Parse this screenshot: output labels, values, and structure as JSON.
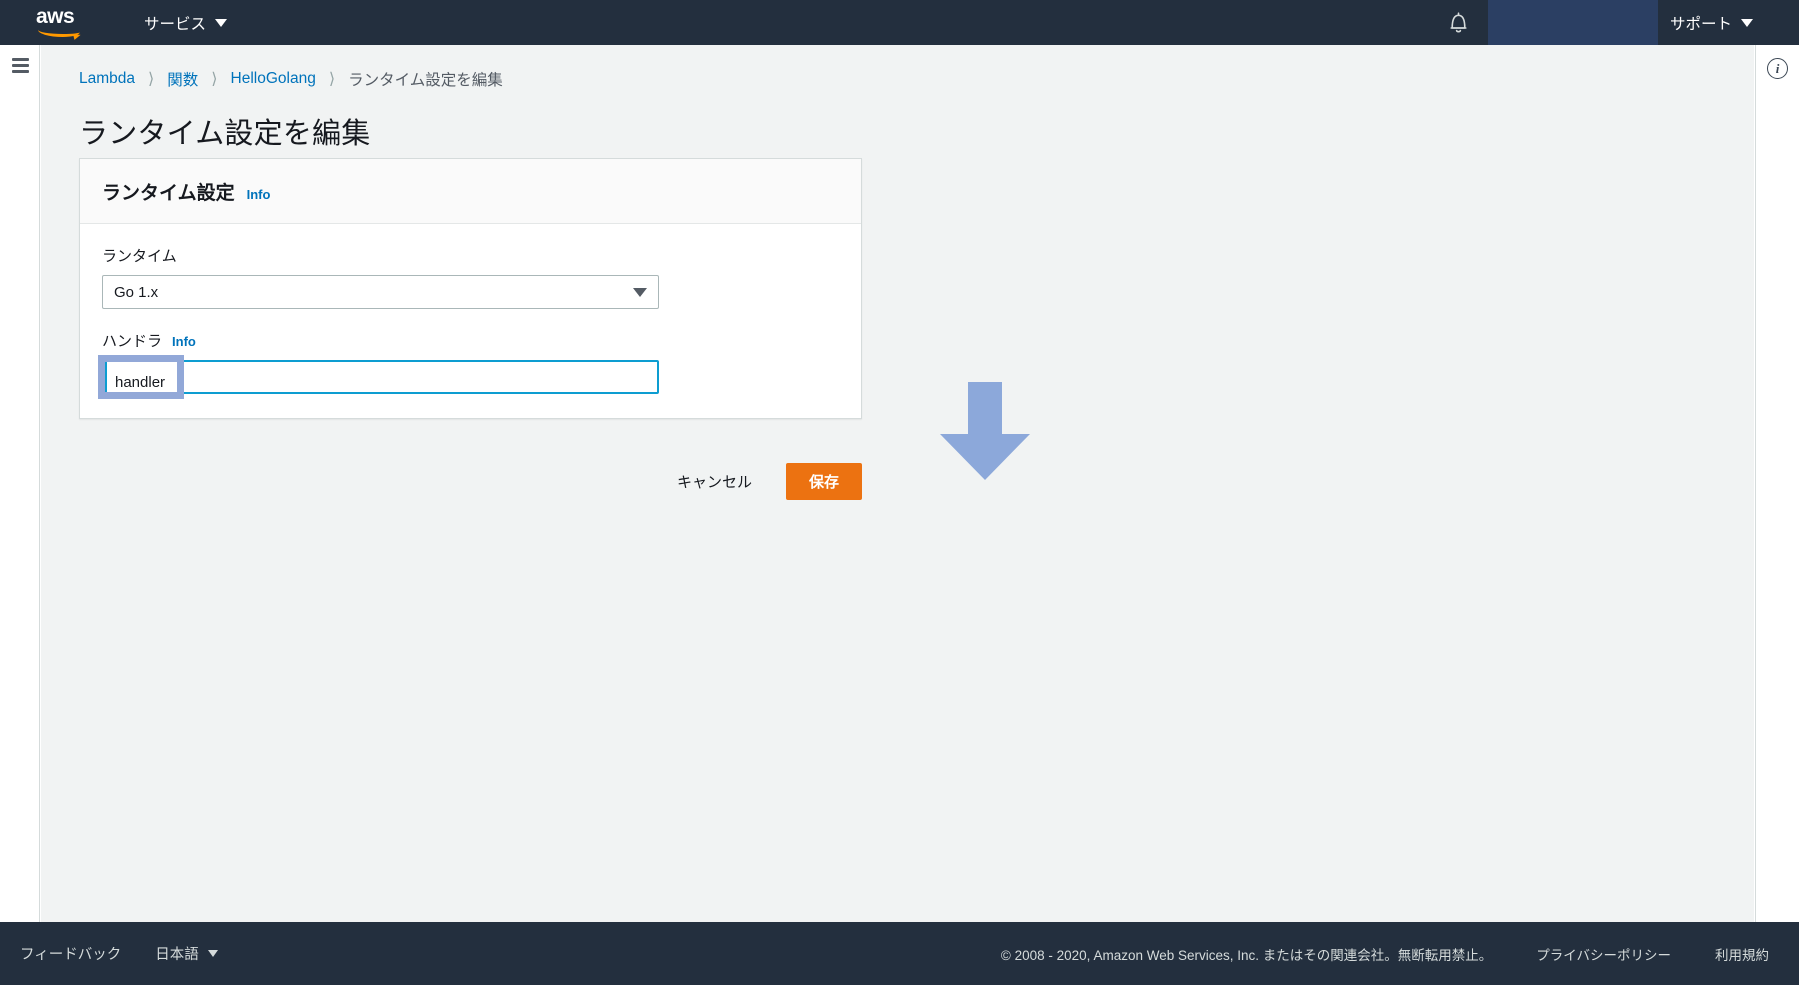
{
  "topnav": {
    "logo_alt": "aws",
    "services_label": "サービス",
    "support_label": "サポート",
    "bell_icon": "notification-bell-icon",
    "account_block_label": ""
  },
  "rails": {
    "menu_icon": "hamburger-menu-icon",
    "info_icon": "info-circle-icon"
  },
  "breadcrumb": {
    "items": [
      {
        "label": "Lambda",
        "is_link": true
      },
      {
        "label": "関数",
        "is_link": true
      },
      {
        "label": "HelloGolang",
        "is_link": true
      },
      {
        "label": "ランタイム設定を編集",
        "is_link": false
      }
    ],
    "separator": "〉"
  },
  "page": {
    "title": "ランタイム設定を編集"
  },
  "card": {
    "title": "ランタイム設定",
    "info_label": "Info",
    "runtime": {
      "label": "ランタイム",
      "selected": "Go 1.x",
      "caret_icon": "chevron-down-icon"
    },
    "handler": {
      "label": "ハンドラ",
      "info_label": "Info",
      "value": "handler",
      "placeholder": "handler"
    }
  },
  "actions": {
    "cancel_label": "キャンセル",
    "save_label": "保存"
  },
  "annotation": {
    "arrow_icon": "down-arrow-annotation",
    "arrow_color": "#8ca8da",
    "highlight_color": "#92a8d8"
  },
  "colors": {
    "nav_bg": "#232f3e",
    "accent_orange": "#ec7211",
    "link_blue": "#0073bb",
    "focus_cyan": "#0d9dd1",
    "page_bg": "#f1f3f3"
  },
  "footer": {
    "feedback_label": "フィードバック",
    "language_label": "日本語",
    "copyright": "© 2008 - 2020, Amazon Web Services, Inc. またはその関連会社。無断転用禁止。",
    "privacy_label": "プライバシーポリシー",
    "terms_label": "利用規約"
  }
}
